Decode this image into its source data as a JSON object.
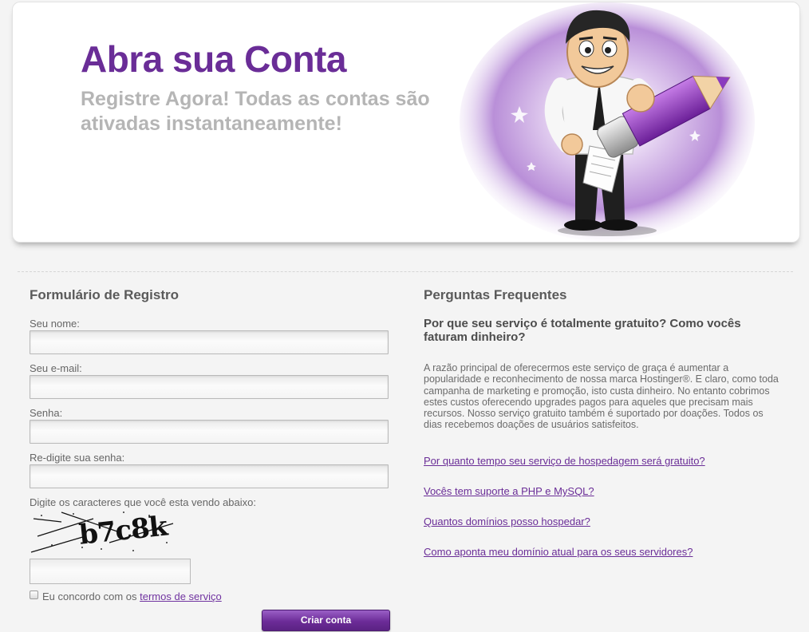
{
  "hero": {
    "title": "Abra sua Conta",
    "subtitle": "Registre Agora! Todas as contas são ativadas instantaneamente!",
    "mascot_icon": "mascot-with-pencil"
  },
  "form": {
    "title": "Formulário de Registro",
    "fields": [
      {
        "label": "Seu nome:",
        "value": ""
      },
      {
        "label": "Seu e-mail:",
        "value": ""
      },
      {
        "label": "Senha:",
        "value": ""
      },
      {
        "label": "Re-digite sua senha:",
        "value": ""
      }
    ],
    "captcha_label": "Digite os caracteres que você esta vendo abaixo:",
    "captcha_text": "b7c8k",
    "captcha_value": "",
    "agree_prefix": "Eu concordo com os",
    "terms_link": "termos de serviço",
    "agree_checked": false,
    "submit_label": "Criar conta"
  },
  "faq": {
    "title": "Perguntas Frequentes",
    "question": "Por que seu serviço é totalmente gratuito? Como vocês faturam dinheiro?",
    "answer": "A razão principal de oferecermos este serviço de graça é aumentar a popularidade e reconhecimento de nossa marca Hostinger®. E claro, como toda campanha de marketing e promoção, isto custa dinheiro. No entanto cobrimos estes custos oferecendo upgrades pagos para aqueles que precisam mais recursos. Nosso serviço gratuito também é suportado por doações. Todos os dias recebemos doações de usuários satisfeitos.",
    "links": [
      "Por quanto tempo seu serviço de hospedagem será gratuito?",
      "Vocês tem suporte a PHP e MySQL?",
      "Quantos domínios posso hospedar?",
      "Como aponta meu domínio atual para os seus servidores?"
    ]
  },
  "colors": {
    "brand_purple": "#6a2d97",
    "subtitle_gray": "#b5b5b5",
    "page_background": "#f4f4f4"
  }
}
